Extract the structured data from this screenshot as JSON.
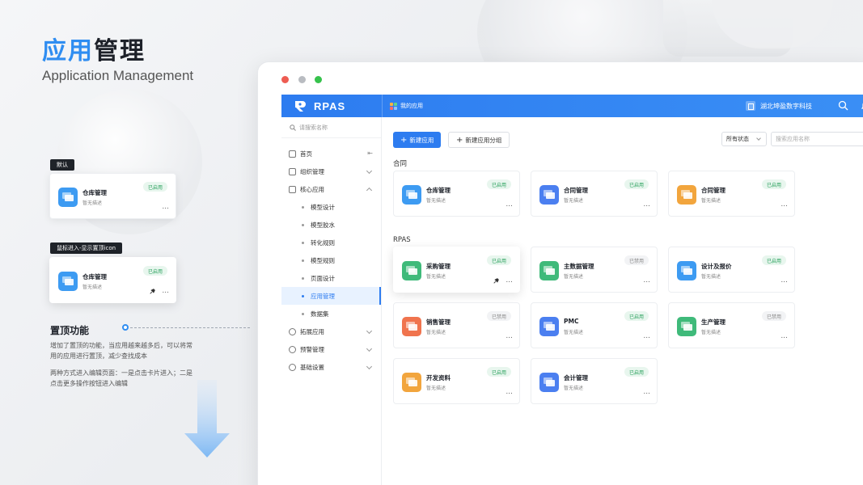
{
  "hero": {
    "title_accent": "应用",
    "title_rest": "管理",
    "subtitle": "Application Management"
  },
  "demo": {
    "tag_default": "默认",
    "tag_hover": "鼠标进入-显示置顶icon",
    "card": {
      "name": "仓库管理",
      "desc": "暂无描述",
      "badge": "已启用",
      "more": "..."
    }
  },
  "feature": {
    "title": "置顶功能",
    "desc1": "增加了置顶的功能，当应用越来越多后，可以将常用的应用进行置顶，减少查找成本",
    "desc2": "两种方式进入编辑页面：一是点击卡片进入；二是点击更多操作按钮进入编辑"
  },
  "app": {
    "logo": "RPAS",
    "my_apps": "我的应用",
    "company": "湖北坤盈数字科技",
    "sidebar": {
      "search_placeholder": "请搜索名称",
      "items": [
        {
          "label": "首页"
        },
        {
          "label": "组织管理"
        },
        {
          "label": "核心应用"
        },
        {
          "label": "模型设计"
        },
        {
          "label": "模型胶水"
        },
        {
          "label": "转化规则"
        },
        {
          "label": "模型规则"
        },
        {
          "label": "页面设计"
        },
        {
          "label": "应用管理"
        },
        {
          "label": "数据集"
        },
        {
          "label": "拓展应用"
        },
        {
          "label": "预警管理"
        },
        {
          "label": "基础设置"
        }
      ]
    },
    "toolbar": {
      "new_app": "新建应用",
      "new_group": "新建应用分组",
      "status_filter": "所有状态",
      "search_placeholder": "搜索应用名称"
    },
    "groups": [
      {
        "title": "合同",
        "cards": [
          {
            "name": "仓库管理",
            "desc": "暂无描述",
            "status": "已启用",
            "color": "#3d9bf2"
          },
          {
            "name": "合同管理",
            "desc": "暂无描述",
            "status": "已启用",
            "color": "#4b7ff0"
          },
          {
            "name": "合同管理",
            "desc": "暂无描述",
            "status": "已启用",
            "color": "#f2a53d"
          }
        ]
      },
      {
        "title": "RPAS",
        "cards": [
          {
            "name": "采购管理",
            "desc": "暂无描述",
            "status": "已启用",
            "color": "#3fba7a"
          },
          {
            "name": "主数据管理",
            "desc": "暂无描述",
            "status": "已禁用",
            "color": "#3fba7a"
          },
          {
            "name": "设计及报价",
            "desc": "暂无描述",
            "status": "已启用",
            "color": "#3d9bf2"
          },
          {
            "name": "销售管理",
            "desc": "暂无描述",
            "status": "已禁用",
            "color": "#f0744e"
          },
          {
            "name": "PMC",
            "desc": "暂无描述",
            "status": "已启用",
            "color": "#4b7ff0"
          },
          {
            "name": "生产管理",
            "desc": "暂无描述",
            "status": "已禁用",
            "color": "#3fba7a"
          },
          {
            "name": "开发资料",
            "desc": "暂无描述",
            "status": "已启用",
            "color": "#f2a53d"
          },
          {
            "name": "会计管理",
            "desc": "暂无描述",
            "status": "已启用",
            "color": "#4b7ff0"
          }
        ]
      }
    ],
    "more_label": "..."
  }
}
